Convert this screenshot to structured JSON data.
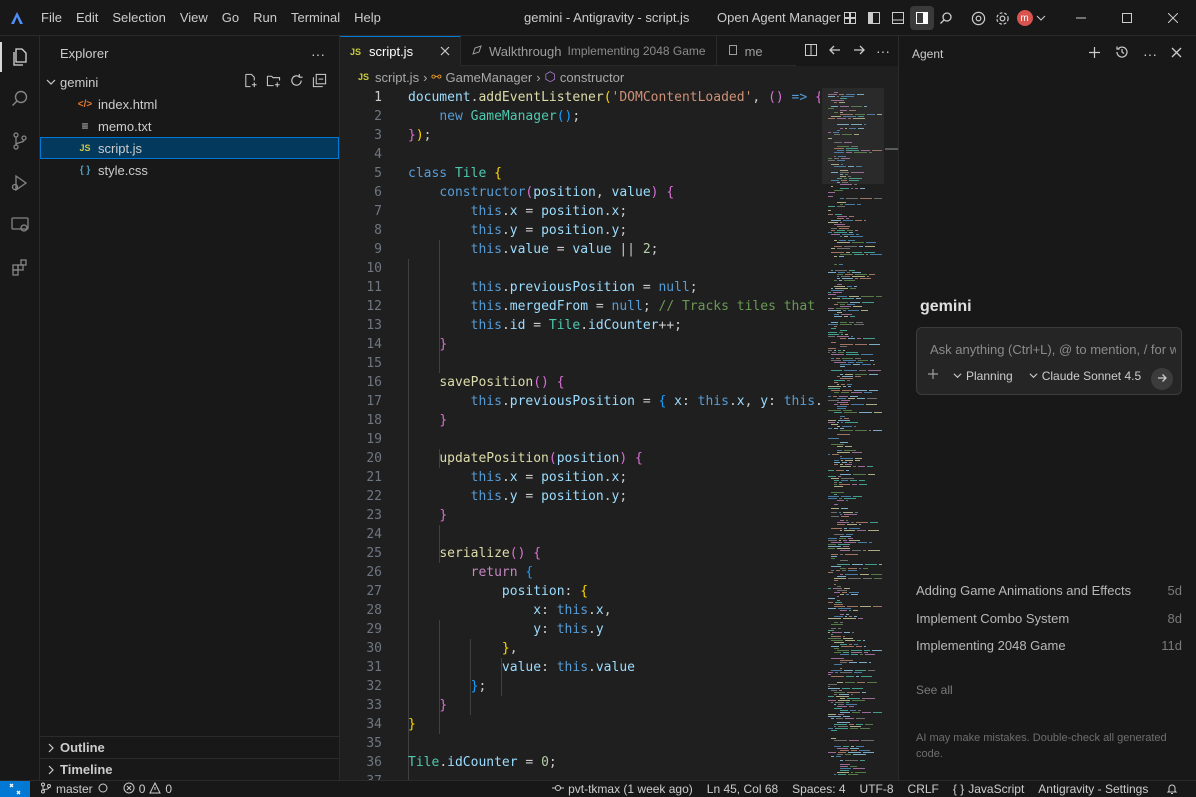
{
  "window": {
    "title": "gemini - Antigravity - script.js",
    "open_agent_manager": "Open Agent Manager",
    "avatar_letter": "m"
  },
  "menu": [
    "File",
    "Edit",
    "Selection",
    "View",
    "Go",
    "Run",
    "Terminal",
    "Help"
  ],
  "sidebar": {
    "title": "Explorer",
    "more": "···",
    "root": "gemini",
    "files": [
      {
        "name": "index.html",
        "icon": "html-file-icon",
        "glyph": "</>",
        "color": "#e37933"
      },
      {
        "name": "memo.txt",
        "icon": "text-file-icon",
        "glyph": "≡",
        "color": "#cccccc"
      },
      {
        "name": "script.js",
        "icon": "js-file-icon",
        "glyph": "JS",
        "color": "#cbcb41"
      },
      {
        "name": "style.css",
        "icon": "css-file-icon",
        "glyph": "{ }",
        "color": "#519aba"
      }
    ],
    "outline": "Outline",
    "timeline": "Timeline"
  },
  "tabs": [
    {
      "label": "script.js",
      "active": true
    },
    {
      "label": "Walkthrough",
      "sub": "Implementing 2048 Game",
      "active": false
    },
    {
      "label": "me",
      "active": false
    }
  ],
  "breadcrumb": {
    "file": "script.js",
    "class": "GameManager",
    "member": "constructor"
  },
  "code": {
    "line_numbers": [
      "1",
      "2",
      "3",
      "4",
      "5",
      "6",
      "7",
      "8",
      "9",
      "10",
      "11",
      "12",
      "13",
      "14",
      "15",
      "16",
      "17",
      "18",
      "19",
      "20",
      "21",
      "22",
      "23",
      "24",
      "25",
      "26",
      "27",
      "28",
      "29",
      "30",
      "31",
      "32",
      "33",
      "34",
      "35",
      "36",
      "37"
    ]
  },
  "agent": {
    "title": "Agent",
    "project": "gemini",
    "placeholder": "Ask anything (Ctrl+L), @ to mention, / for workflows",
    "mode": "Planning",
    "model": "Claude Sonnet 4.5",
    "conversations": [
      {
        "title": "Adding Game Animations and Effects",
        "age": "5d"
      },
      {
        "title": "Implement Combo System",
        "age": "8d"
      },
      {
        "title": "Implementing 2048 Game",
        "age": "11d"
      }
    ],
    "see_all": "See all",
    "disclaimer": "AI may make mistakes. Double-check all generated code."
  },
  "status": {
    "branch": "master",
    "errors": "0",
    "warnings": "0",
    "blame": "pvt-tkmax (1 week ago)",
    "cursor": "Ln 45, Col 68",
    "spaces": "Spaces: 4",
    "encoding": "UTF-8",
    "eol": "CRLF",
    "language": "JavaScript",
    "settings": "Antigravity - Settings"
  }
}
